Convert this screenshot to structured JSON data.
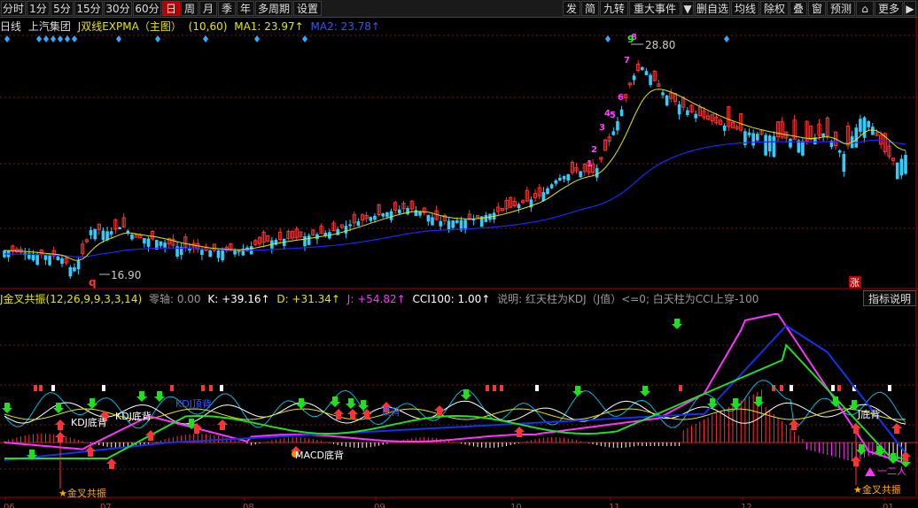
{
  "toolbar": {
    "periods": [
      "分时",
      "1分",
      "5分",
      "15分",
      "30分",
      "60分",
      "日",
      "周",
      "月",
      "季",
      "年",
      "多周期",
      "设置"
    ],
    "active_period": "日",
    "right_buttons": [
      "发",
      "简",
      "九转",
      "重大事件",
      "▼",
      "删自选",
      "均线",
      "除权",
      "叠",
      "窗",
      "预测",
      "⌂",
      "更多",
      "▶"
    ]
  },
  "main": {
    "period_label": "日线",
    "stock_name": "上汽集团",
    "indicator_name": "J双线EXPMA（主图）",
    "params": "(10,60)",
    "ma1_label": "MA1: 23.97↑",
    "ma2_label": "MA2: 23.78↑",
    "high_label": "28.80",
    "low_label": "16.90",
    "q_mark": "q",
    "nine_mark": "9",
    "zhang_badge": "涨",
    "colors": {
      "ma1": "#e6e600",
      "ma2": "#2222ff",
      "up": "#ff3333",
      "down": "#33ccff",
      "diamond": "#33aaff"
    }
  },
  "sub": {
    "indicator_name": "J金叉共振(12,26,9,9,3,3,14)",
    "zero_axis": "零轴: 0.00",
    "k_label": "K: +39.16↑",
    "d_label": "D: +31.34↑",
    "j_label": "J: +54.82↑",
    "cci_label": "CCI100: 1.00↑",
    "description": "说明: 红天柱为KDJ（J值）<=0; 白天柱为CCI上穿-100",
    "explain_button": "指标说明",
    "annotations": {
      "kdj_bottom_1": "KDJ底背",
      "kdj_bottom_2": "KDJ底背",
      "kdj_top": "KDJ顶背",
      "mid_label": "顶背",
      "macd_bottom": "MACD底背",
      "golden_1": "★金叉共振",
      "golden_2": "★金叉共振",
      "right_label": "J底背",
      "small_right": "一二人"
    },
    "colors": {
      "k": "#ffffff",
      "d": "#ffff00",
      "j": "#ff33ff",
      "cci": "#00ccff",
      "macd_up": "#ff3333",
      "macd_down": "#ffffff"
    }
  },
  "axis": {
    "months": [
      "06",
      "07",
      "08",
      "09",
      "10",
      "11",
      "12",
      "01"
    ]
  }
}
